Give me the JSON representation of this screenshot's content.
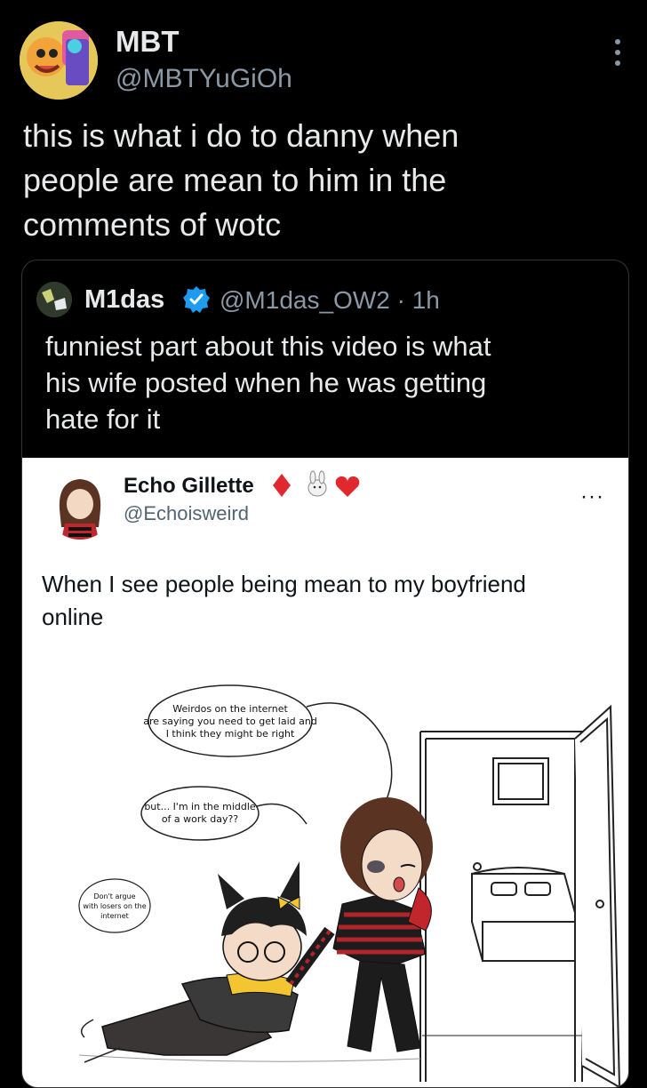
{
  "post": {
    "author_name": "MBT",
    "author_handle": "@MBTYuGiOh",
    "text_lines": [
      "this is what i do to danny when",
      "people are mean to him in the",
      "comments of wotc"
    ]
  },
  "quote": {
    "author_name": "M1das",
    "author_handle_time": "@M1das_OW2 · 1h",
    "text_lines": [
      "funniest part about this video is what",
      "his wife posted when he was getting",
      "hate for it"
    ]
  },
  "embedded": {
    "name": "Echo Gillette",
    "handle": "@Echoisweird",
    "more": "···",
    "text_lines": [
      "When I see people being mean to my boyfriend",
      "online"
    ],
    "comic": {
      "bubble1": [
        "Weirdos on the internet",
        "are saying you need to get laid and",
        "I think they might be right"
      ],
      "bubble2": [
        "but... I'm in the middle",
        "of a work day??"
      ],
      "bubble3": [
        "Don't argue",
        "with losers on the",
        "internet"
      ]
    }
  },
  "colors": {
    "background": "#000000",
    "text": "#e7e9ea",
    "secondary": "#8b98a5",
    "verified": "#1d9bf0",
    "border": "#333639"
  }
}
